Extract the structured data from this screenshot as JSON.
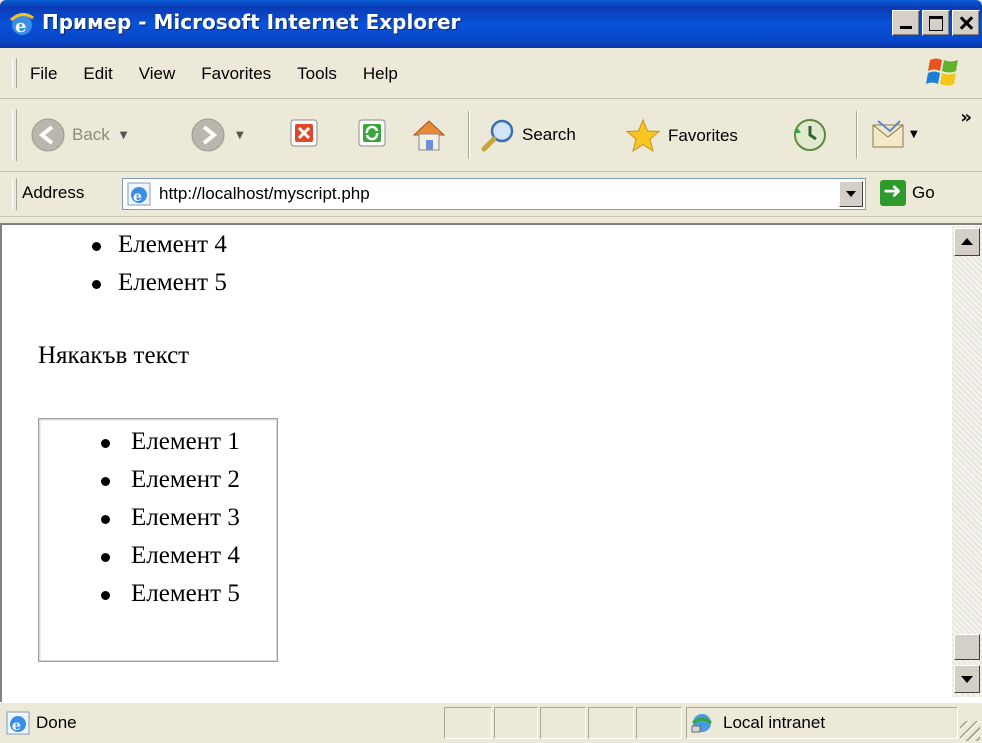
{
  "window": {
    "title": "Пример - Microsoft Internet Explorer"
  },
  "menu": {
    "items": [
      "File",
      "Edit",
      "View",
      "Favorites",
      "Tools",
      "Help"
    ]
  },
  "toolbar": {
    "back_label": "Back",
    "search_label": "Search",
    "favorites_label": "Favorites",
    "overflow": "»"
  },
  "address": {
    "label": "Address",
    "url": "http://localhost/myscript.php",
    "go_label": "Go"
  },
  "content": {
    "top_list": [
      "Елемент 4",
      "Елемент 5"
    ],
    "paragraph": "Някакъв текст",
    "boxed_list": [
      "Елемент 1",
      "Елемент 2",
      "Елемент 3",
      "Елемент 4",
      "Елемент 5"
    ]
  },
  "status": {
    "text": "Done",
    "zone": "Local intranet"
  },
  "colors": {
    "titlebar": "#0a5fd6",
    "chrome": "#ece9d8",
    "page_bg": "#ffffff"
  },
  "icons": {
    "title": "ie-logo-icon",
    "back": "back-arrow-icon",
    "forward": "forward-arrow-icon",
    "stop": "stop-icon",
    "refresh": "refresh-icon",
    "home": "home-icon",
    "search": "search-magnifier-icon",
    "favorites": "favorites-star-icon",
    "history": "history-icon",
    "mail": "mail-icon",
    "go": "go-arrow-icon",
    "zone": "local-intranet-icon"
  }
}
